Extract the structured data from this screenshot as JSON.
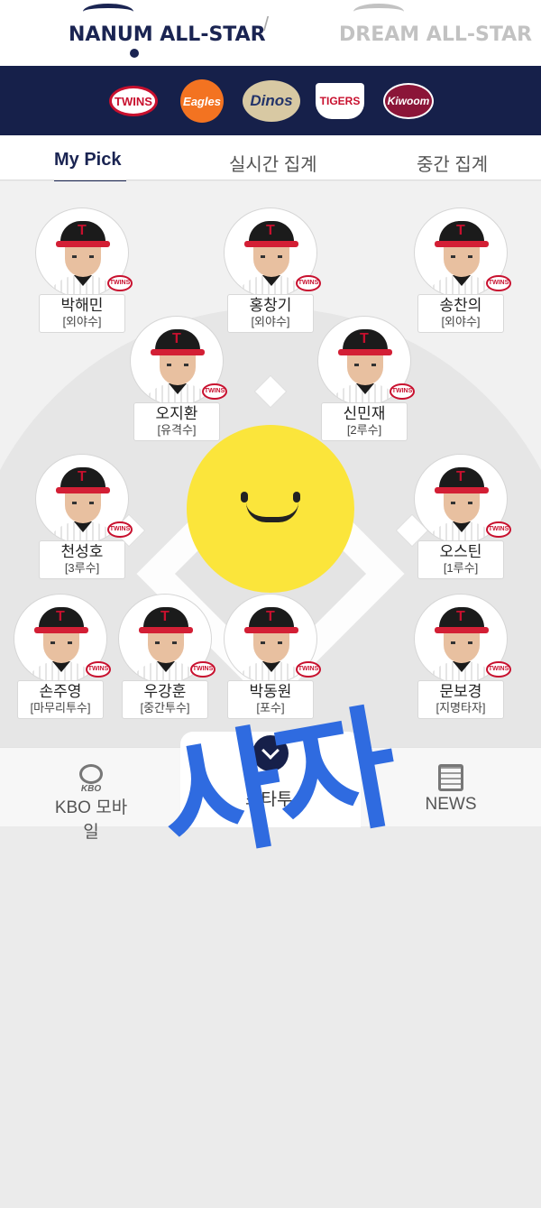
{
  "header": {
    "leagues": [
      {
        "name": "NANUM ALL-STAR",
        "selected": true
      },
      {
        "name": "DREAM ALL-STAR",
        "selected": false
      }
    ],
    "separator": "/"
  },
  "teams": [
    {
      "name": "TWINS",
      "icon": "twins-logo"
    },
    {
      "name": "Eagles",
      "icon": "eagles-logo"
    },
    {
      "name": "Dinos",
      "icon": "dinos-logo"
    },
    {
      "name": "TIGERS",
      "icon": "tigers-logo"
    },
    {
      "name": "Kiwoom",
      "icon": "kiwoom-logo"
    }
  ],
  "tabs": [
    {
      "label": "My Pick",
      "active": true
    },
    {
      "label": "실시간 집계",
      "active": false
    },
    {
      "label": "중간 집계",
      "active": false
    }
  ],
  "players": [
    {
      "name": "박해민",
      "position": "[외야수]"
    },
    {
      "name": "홍창기",
      "position": "[외야수]"
    },
    {
      "name": "송찬의",
      "position": "[외야수]"
    },
    {
      "name": "오지환",
      "position": "[유격수]"
    },
    {
      "name": "신민재",
      "position": "[2루수]"
    },
    {
      "name": "천성호",
      "position": "[3루수]"
    },
    {
      "name": "오스틴",
      "position": "[1루수]"
    },
    {
      "name": "손주영",
      "position": "[마무리투수]"
    },
    {
      "name": "우강훈",
      "position": "[중간투수]"
    },
    {
      "name": "박동원",
      "position": "[포수]"
    },
    {
      "name": "문보경",
      "position": "[지명타자]"
    }
  ],
  "team_badge": "TWINS",
  "bottom_nav": {
    "kbo_small": "KBO",
    "kbo": "KBO 모바일",
    "center": "스타투",
    "news": "NEWS"
  },
  "watermark": "사자",
  "colors": {
    "navy": "#16204a",
    "twins_red": "#c8102e",
    "smiley_yellow": "#fbe53b",
    "watermark_blue": "#2f6be0"
  }
}
